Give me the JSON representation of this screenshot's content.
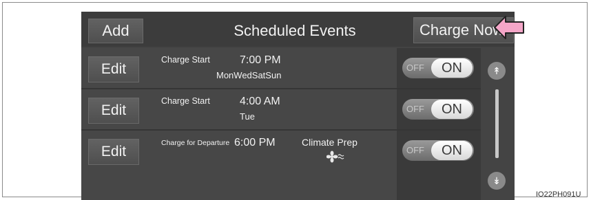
{
  "header": {
    "add_label": "Add",
    "title": "Scheduled Events",
    "charge_now_label": "Charge Now"
  },
  "events": [
    {
      "edit_label": "Edit",
      "type": "Charge Start",
      "time": "7:00 PM",
      "days": "MonWedSatSun",
      "extra": "",
      "toggle_off": "OFF",
      "toggle_on": "ON",
      "state": "on"
    },
    {
      "edit_label": "Edit",
      "type": "Charge Start",
      "time": "4:00 AM",
      "days": "Tue",
      "extra": "",
      "toggle_off": "OFF",
      "toggle_on": "ON",
      "state": "on"
    },
    {
      "edit_label": "Edit",
      "type": "Charge for Departure",
      "time": "6:00 PM",
      "days": "",
      "extra": "Climate Prep",
      "toggle_off": "OFF",
      "toggle_on": "ON",
      "state": "on"
    }
  ],
  "scroll": {
    "up_icon": "double-chevron-up-icon",
    "down_icon": "double-chevron-down-icon"
  },
  "colors": {
    "screen_bg": "#444444",
    "pointer": "#f4a6c8"
  },
  "caption": "IO22PH091U"
}
